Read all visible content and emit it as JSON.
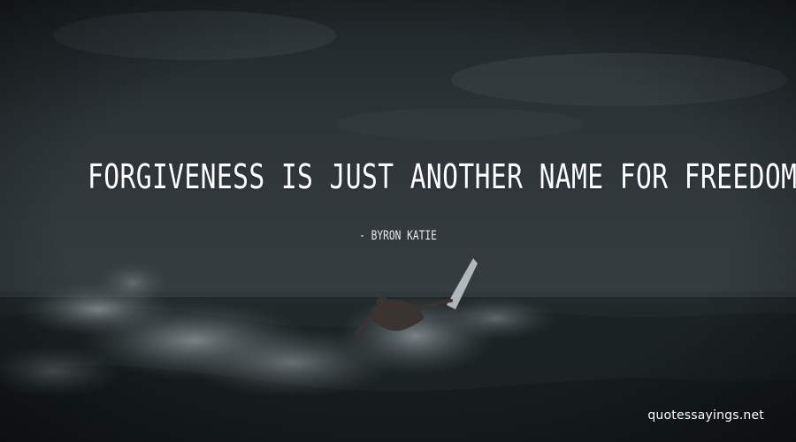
{
  "quote": {
    "text": "FORGIVENESS IS JUST ANOTHER NAME FOR FREEDOM.",
    "author": "- BYRON KATIE"
  },
  "watermark": {
    "text": "quotessayings.net"
  },
  "colors": {
    "sky": "#2b3235",
    "sea": "#1c2426",
    "foam": "#6f7a7c",
    "text": "#ffffff"
  },
  "icons": {
    "surfer": "surfer-silhouette-icon"
  }
}
